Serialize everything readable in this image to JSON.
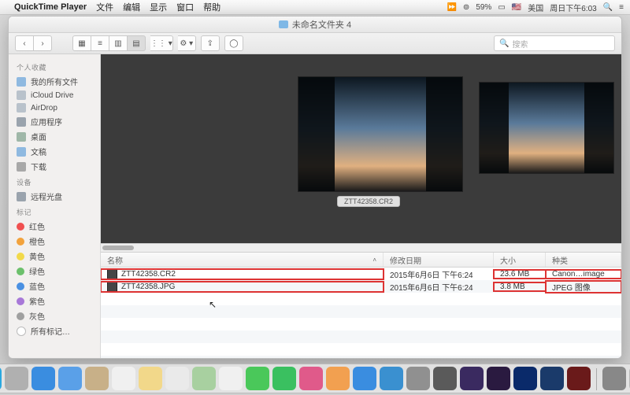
{
  "menubar": {
    "app": "QuickTime Player",
    "items": [
      "文件",
      "编辑",
      "显示",
      "窗口",
      "帮助"
    ],
    "battery": "59%",
    "flag": "美国",
    "clock": "周日下午6:03"
  },
  "window": {
    "title": "未命名文件夹 4"
  },
  "toolbar": {
    "search_placeholder": "搜索"
  },
  "sidebar": {
    "heads": {
      "fav": "个人收藏",
      "dev": "设备",
      "tags": "标记"
    },
    "fav": [
      "我的所有文件",
      "iCloud Drive",
      "AirDrop",
      "应用程序",
      "桌面",
      "文稿",
      "下载"
    ],
    "dev": [
      "远程光盘"
    ],
    "tags": [
      {
        "label": "红色",
        "color": "#f05050"
      },
      {
        "label": "橙色",
        "color": "#f2a23c"
      },
      {
        "label": "黄色",
        "color": "#f2d94a"
      },
      {
        "label": "绿色",
        "color": "#6cc06c"
      },
      {
        "label": "蓝色",
        "color": "#4a90e2"
      },
      {
        "label": "紫色",
        "color": "#a878d8"
      },
      {
        "label": "灰色",
        "color": "#a0a0a0"
      }
    ],
    "all_tags": "所有标记…"
  },
  "preview": {
    "caption": "ZTT42358.CR2"
  },
  "columns": {
    "name": "名称",
    "date": "修改日期",
    "size": "大小",
    "kind": "种类"
  },
  "files": [
    {
      "name": "ZTT42358.CR2",
      "date": "2015年6月6日 下午6:24",
      "size": "23.6 MB",
      "kind": "Canon…image"
    },
    {
      "name": "ZTT42358.JPG",
      "date": "2015年6月6日 下午6:24",
      "size": "3.8 MB",
      "kind": "JPEG 图像"
    }
  ],
  "dock": {
    "apps": [
      {
        "n": "finder",
        "c": "#2aa8e0"
      },
      {
        "n": "launchpad",
        "c": "#b0b0b0"
      },
      {
        "n": "safari",
        "c": "#3a8de0"
      },
      {
        "n": "mail",
        "c": "#5aa0e8"
      },
      {
        "n": "contacts",
        "c": "#c8b088"
      },
      {
        "n": "calendar",
        "c": "#f0f0f0"
      },
      {
        "n": "notes",
        "c": "#f2d88a"
      },
      {
        "n": "reminders",
        "c": "#eaeaea"
      },
      {
        "n": "maps",
        "c": "#a8d0a0"
      },
      {
        "n": "photos",
        "c": "#f0f0f0"
      },
      {
        "n": "messages",
        "c": "#4ac85a"
      },
      {
        "n": "facetime",
        "c": "#3ac060"
      },
      {
        "n": "itunes",
        "c": "#e05a8a"
      },
      {
        "n": "ibooks",
        "c": "#f2a050"
      },
      {
        "n": "appstore",
        "c": "#3a8de0"
      },
      {
        "n": "preview",
        "c": "#3a90d0"
      },
      {
        "n": "settings",
        "c": "#909090"
      },
      {
        "n": "quicktime",
        "c": "#5a5a5a"
      },
      {
        "n": "after-effects",
        "c": "#3a2a60"
      },
      {
        "n": "premiere",
        "c": "#2a1a40"
      },
      {
        "n": "mystery-q",
        "c": "#0a2a6a"
      },
      {
        "n": "photoshop",
        "c": "#1a3a6a"
      },
      {
        "n": "adobe-app",
        "c": "#6a1a1a"
      }
    ],
    "right": [
      {
        "n": "downloads-stack",
        "c": "#888"
      },
      {
        "n": "trash",
        "c": "#b8b8b8"
      }
    ]
  }
}
